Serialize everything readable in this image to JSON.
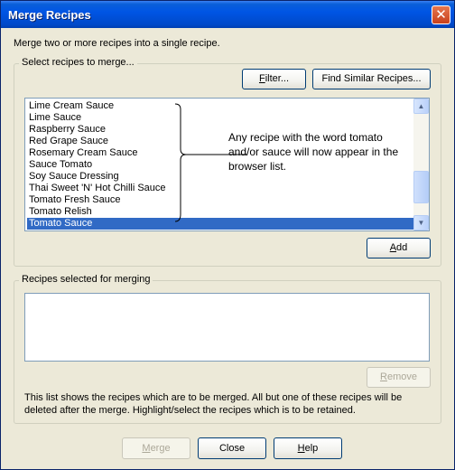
{
  "window": {
    "title": "Merge Recipes",
    "close_label": "✕"
  },
  "intro_text": "Merge two or more recipes into a single recipe.",
  "select_group": {
    "legend": "Select recipes to merge...",
    "filter_label": "Filter...",
    "find_similar_label": "Find Similar Recipes...",
    "items": [
      "Lime Cream Sauce",
      "Lime Sauce",
      "Raspberry Sauce",
      "Red Grape Sauce",
      "Rosemary Cream Sauce",
      "Sauce Tomato",
      "Soy Sauce Dressing",
      "Thai Sweet 'N' Hot Chilli Sauce",
      "Tomato Fresh Sauce",
      "Tomato Relish",
      "Tomato Sauce"
    ],
    "selected_item": "Tomato Sauce",
    "annotation": "Any recipe with the word tomato and/or sauce will now appear in the browser list.",
    "add_label": "Add"
  },
  "merge_group": {
    "legend": "Recipes selected for merging",
    "remove_label": "Remove",
    "info_text": "This list shows the recipes which are to be merged.  All but one of these recipes will be deleted after the merge.  Highlight/select the recipes which is to be retained."
  },
  "footer": {
    "merge_label": "Merge",
    "close_label": "Close",
    "help_label": "Help"
  }
}
